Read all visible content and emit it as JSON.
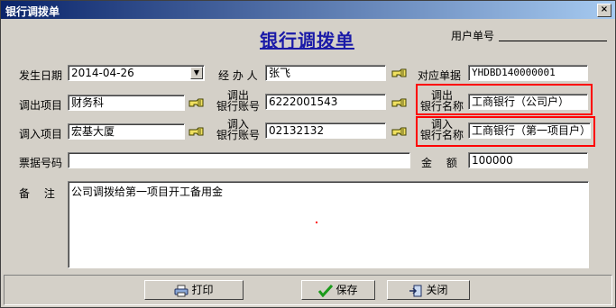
{
  "window": {
    "title": "银行调拨单",
    "close_label": "×"
  },
  "form": {
    "title": "银行调拨单",
    "user_no_label": "用户单号",
    "user_no_value": "",
    "date_label": "发生日期",
    "date_value": "2014-04-26",
    "handler_label": "经 办 人",
    "handler_value": "张飞",
    "ref_label": "对应单据",
    "ref_value": "YHDBD140000001",
    "out_project_label": "调出项目",
    "out_project_value": "财务科",
    "out_account_label_1": "调出",
    "out_account_label_2": "银行账号",
    "out_account_value": "6222001543",
    "out_bank_label_1": "调出",
    "out_bank_label_2": "银行名称",
    "out_bank_value": "工商银行（公司户）",
    "in_project_label": "调入项目",
    "in_project_value": "宏基大厦",
    "in_account_label_1": "调入",
    "in_account_label_2": "银行账号",
    "in_account_value": "02132132",
    "in_bank_label_1": "调入",
    "in_bank_label_2": "银行名称",
    "in_bank_value": "工商银行（第一项目户）",
    "voucher_label": "票据号码",
    "voucher_value": "",
    "amount_label": "金　 额",
    "amount_value": "100000",
    "remark_label": "备　 注",
    "remark_value": "公司调拨给第一项目开工备用金"
  },
  "buttons": {
    "print": "打印",
    "save": "保存",
    "close": "关闭"
  }
}
